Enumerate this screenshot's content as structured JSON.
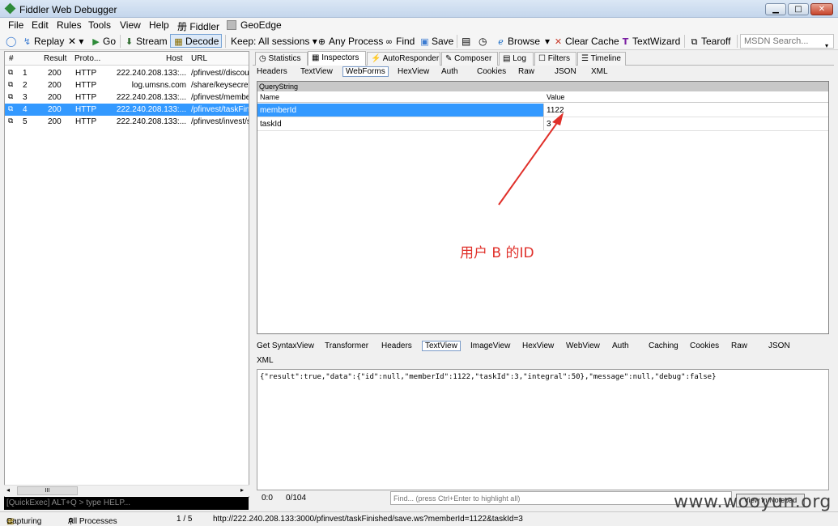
{
  "title": "Fiddler Web Debugger",
  "window_buttons": {
    "minimize": "▁",
    "maximize": "□",
    "close": "✕"
  },
  "menu": [
    "File",
    "Edit",
    "Rules",
    "Tools",
    "View",
    "Help",
    "册 Fiddler",
    "GeoEdge"
  ],
  "toolbar": {
    "replay": "Replay",
    "x": "✕ ▾",
    "go": "Go",
    "stream": "Stream",
    "decode": "Decode",
    "keep": "Keep: All sessions ▾",
    "any_process": "Any Process",
    "find": "Find",
    "save": "Save",
    "browse": "Browse",
    "clear_cache": "Clear Cache",
    "textwizard": "TextWizard",
    "tearoff": "Tearoff",
    "msdn_placeholder": "MSDN Search..."
  },
  "sessions": {
    "columns": [
      "#",
      "Result",
      "Proto...",
      "Host",
      "URL"
    ],
    "rows": [
      {
        "id": "1",
        "result": "200",
        "proto": "HTTP",
        "host": "222.240.208.133:...",
        "url": "/pfinvest//discou"
      },
      {
        "id": "2",
        "result": "200",
        "proto": "HTTP",
        "host": "log.umsns.com",
        "url": "/share/keysecret"
      },
      {
        "id": "3",
        "result": "200",
        "proto": "HTTP",
        "host": "222.240.208.133:...",
        "url": "/pfinvest/member"
      },
      {
        "id": "4",
        "result": "200",
        "proto": "HTTP",
        "host": "222.240.208.133:...",
        "url": "/pfinvest/taskFini"
      },
      {
        "id": "5",
        "result": "200",
        "proto": "HTTP",
        "host": "222.240.208.133:...",
        "url": "/pfinvest/invest/s"
      }
    ],
    "selected_index": 3
  },
  "hscroll_grip": "III",
  "quickexec": "[QuickExec] ALT+Q > type HELP...",
  "top_tabs": [
    "Statistics",
    "Inspectors",
    "AutoResponder",
    "Composer",
    "Log",
    "Filters",
    "Timeline"
  ],
  "request_tabs": [
    "Headers",
    "TextView",
    "WebForms",
    "HexView",
    "Auth",
    "Cookies",
    "Raw",
    "JSON",
    "XML"
  ],
  "querystring": {
    "title": "QueryString",
    "columns": [
      "Name",
      "Value"
    ],
    "rows": [
      {
        "name": "memberId",
        "value": "1122"
      },
      {
        "name": "taskId",
        "value": "3"
      }
    ]
  },
  "annotation": "用户 B 的ID",
  "response_tabs": [
    "Get SyntaxView",
    "Transformer",
    "Headers",
    "TextView",
    "ImageView",
    "HexView",
    "WebView",
    "Auth",
    "Caching",
    "Cookies",
    "Raw",
    "JSON",
    "XML"
  ],
  "response_body": "{\"result\":true,\"data\":{\"id\":null,\"memberId\":1122,\"taskId\":3,\"integral\":50},\"message\":null,\"debug\":false}",
  "response_footer": {
    "pos": "0:0",
    "count": "0/104",
    "find_placeholder": "Find... (press Ctrl+Enter to highlight all)",
    "notepad": "View in Notepad"
  },
  "status": {
    "capturing": "Capturing",
    "processes": "All Processes",
    "count": "1 / 5",
    "url": "http://222.240.208.133:3000/pfinvest/taskFinished/save.ws?memberId=1122&taskId=3"
  },
  "watermark": "www.wooyun.org",
  "colors": {
    "selection": "#3399ff",
    "annotation": "#e0302a"
  }
}
